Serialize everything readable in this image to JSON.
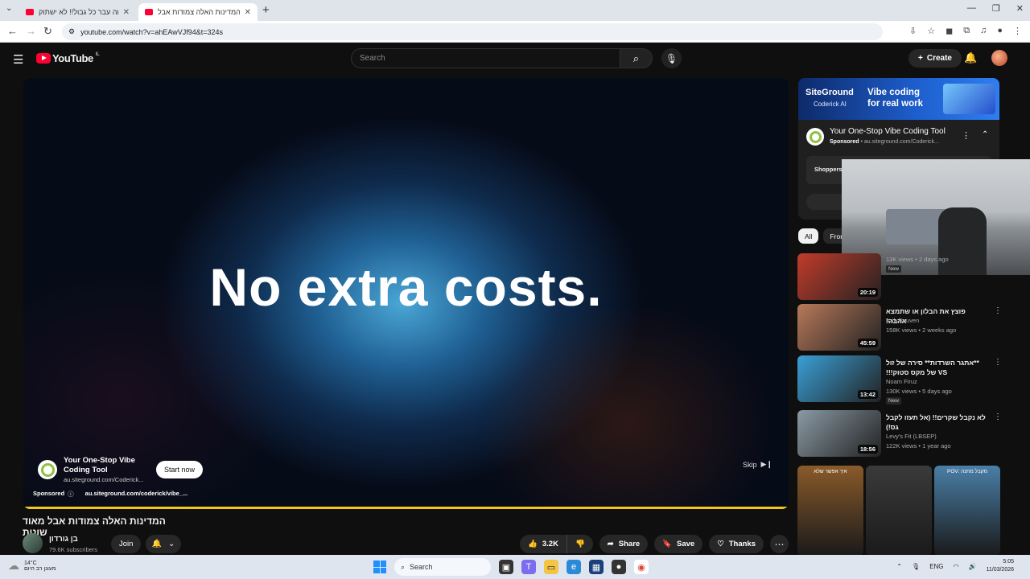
{
  "browser": {
    "tabs": [
      {
        "title": "זה עבר כל גבול!! לא ישתוק - e",
        "active": false
      },
      {
        "title": "המדינות האלה צמודות אבל",
        "active": true
      }
    ],
    "url": "youtube.com/watch?v=ahEAwVJf94&t=324s"
  },
  "youtube": {
    "logo_text": "YouTube",
    "country": "IL",
    "search_placeholder": "Search",
    "create_label": "Create"
  },
  "player": {
    "overlay_text": "No extra costs.",
    "ad_title": "Your One-Stop Vibe Coding Tool",
    "ad_domain": "au.siteground.com/Coderick...",
    "start_label": "Start now",
    "skip_label": "Skip",
    "sponsored_label": "Sponsored",
    "sponsored_url": "au.siteground.com/coderick/vibe_...",
    "progress": 1.0,
    "progress_color": "#f5c518"
  },
  "video": {
    "title": "המדינות האלה צמודות אבל מאוד שונות",
    "channel_name": "בן גורדון",
    "subscribers": "79.6K subscribers",
    "join_label": "Join",
    "likes": "3.2K",
    "share_label": "Share",
    "save_label": "Save",
    "thanks_label": "Thanks"
  },
  "side_ad": {
    "brand": "SiteGround",
    "brand_sub": "Coderick AI",
    "headline_line1": "Vibe coding",
    "headline_line2": "for real work",
    "title": "Your One-Stop Vibe Coding Tool",
    "sponsored": "Sponsored",
    "domain": "au.siteground.com/Coderick...",
    "shoppers_text": "Shoppers s"
  },
  "chips": [
    "All",
    "From"
  ],
  "recommendations": [
    {
      "title": "",
      "channel": "",
      "views": "13K views • 2 days ago",
      "duration": "20:19",
      "new": "New",
      "thumb_color": "#c23b2a"
    },
    {
      "title": "פוצץ את הבלון או שתמצא אהבה!",
      "channel": "Itzik Reuven",
      "views": "158K views • 2 weeks ago",
      "duration": "45:59",
      "new": "",
      "thumb_color": "#b8795a"
    },
    {
      "title": "**אתגר השרדות** סירה של זול VS של מקס סטוק!!!",
      "channel": "Noam Firuz",
      "views": "130K views • 5 days ago",
      "duration": "13:42",
      "new": "New",
      "thumb_color": "#3aa0d8"
    },
    {
      "title": "לא נקבל שקרים!! (אל תעזו לקבל גס!)",
      "channel": "Levy's Fit (LBSEP)",
      "views": "122K views • 1 year ago",
      "duration": "18:56",
      "new": "",
      "thumb_color": "#8a9aa5"
    }
  ],
  "shorts": [
    {
      "label": "איך אפשר שלא",
      "color": "#8a5a2a"
    },
    {
      "label": "",
      "color": "#3a3a3a"
    },
    {
      "label": "POV: מקבל מתנה",
      "color": "#4a7fa8"
    }
  ],
  "taskbar": {
    "temperature": "14°C",
    "weather_desc": "מעונן רב היום",
    "search_label": "Search",
    "lang": "ENG",
    "time": "5:05",
    "date": "11/03/2026"
  }
}
